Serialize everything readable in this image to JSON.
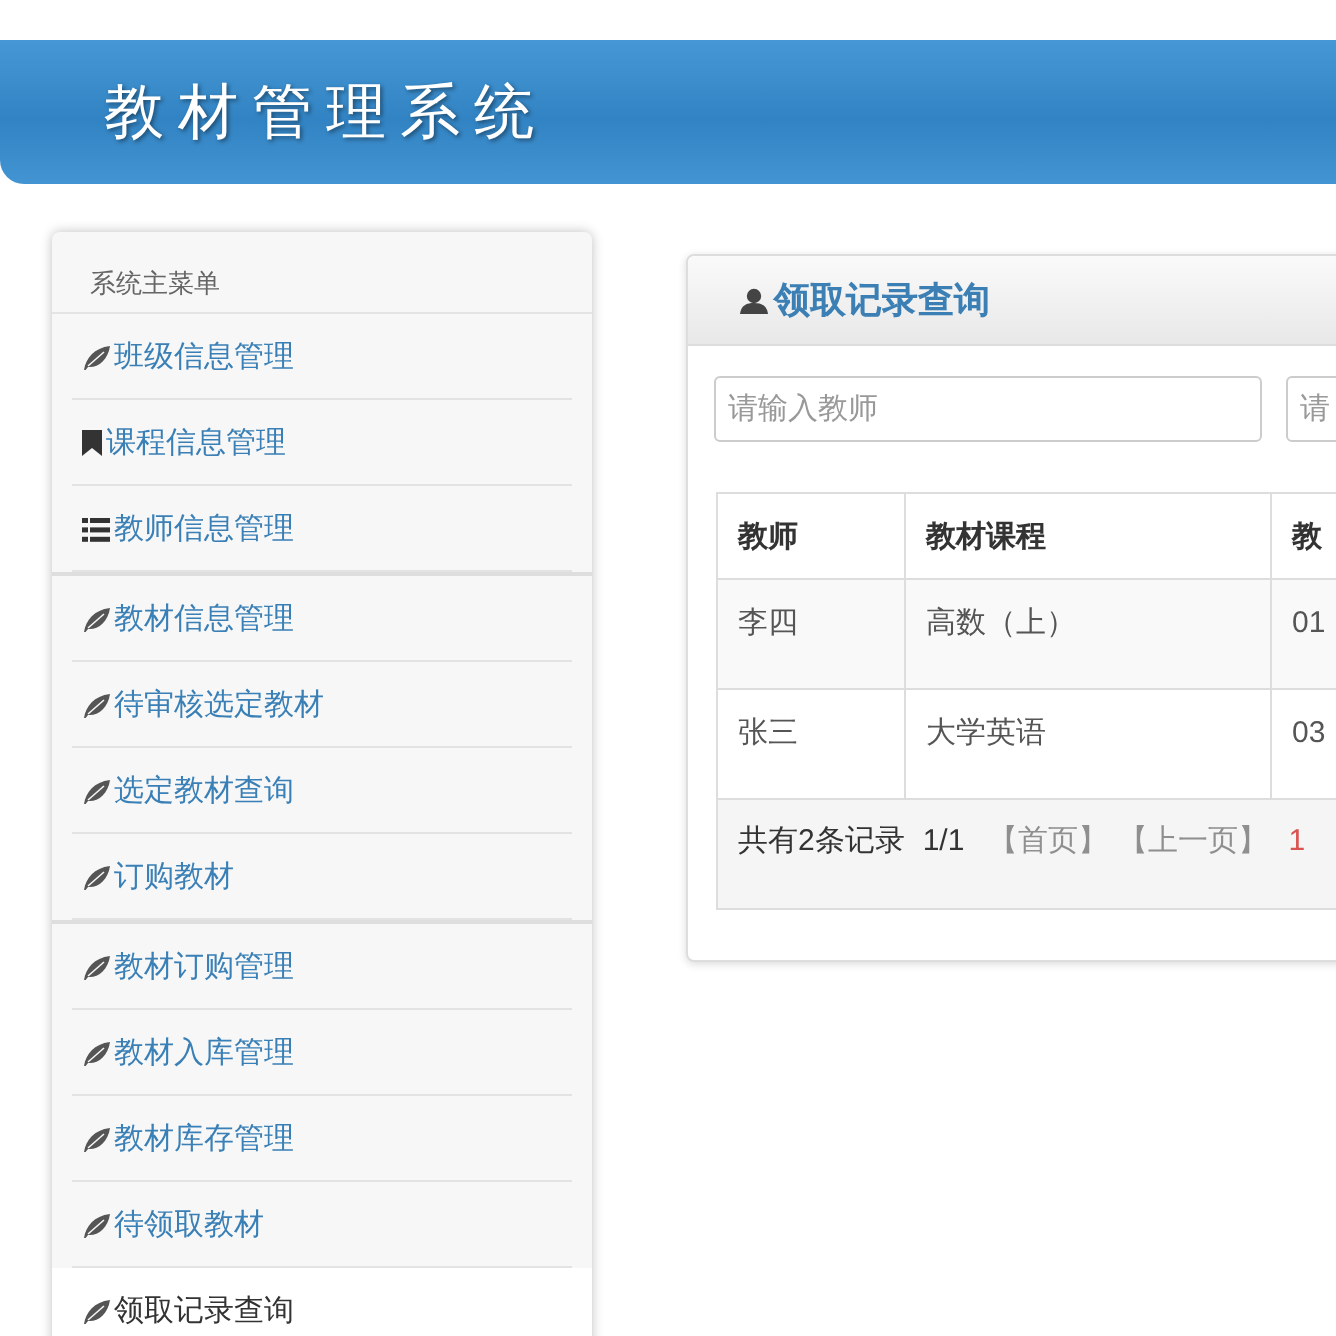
{
  "header": {
    "title": "教材管理系统"
  },
  "sidebar": {
    "heading": "系统主菜单",
    "groups": [
      {
        "items": [
          {
            "label": "班级信息管理",
            "selected": false
          },
          {
            "label": "课程信息管理",
            "selected": false
          },
          {
            "label": "教师信息管理",
            "selected": false
          }
        ]
      },
      {
        "items": [
          {
            "label": "教材信息管理",
            "selected": false
          },
          {
            "label": "待审核选定教材",
            "selected": false
          },
          {
            "label": "选定教材查询",
            "selected": false
          },
          {
            "label": "订购教材",
            "selected": false
          }
        ]
      },
      {
        "items": [
          {
            "label": "教材订购管理",
            "selected": false
          },
          {
            "label": "教材入库管理",
            "selected": false
          },
          {
            "label": "教材库存管理",
            "selected": false
          },
          {
            "label": "待领取教材",
            "selected": false
          },
          {
            "label": "领取记录查询",
            "selected": true
          }
        ]
      }
    ]
  },
  "panel": {
    "title": "领取记录查询",
    "filters": [
      {
        "placeholder": "请输入教师"
      },
      {
        "placeholder": "请"
      }
    ],
    "table": {
      "columns": [
        "教师",
        "教材课程",
        "教"
      ],
      "rows": [
        [
          "李四",
          "高数（上）",
          "01"
        ],
        [
          "张三",
          "大学英语",
          "03"
        ]
      ]
    },
    "pagination": {
      "summary": "共有2条记录",
      "page": "1/1",
      "links": [
        {
          "label": "【首页】",
          "disabled": true
        },
        {
          "label": "【上一页】",
          "disabled": true
        }
      ],
      "pages": [
        {
          "label": "1",
          "selected": true
        }
      ]
    }
  }
}
